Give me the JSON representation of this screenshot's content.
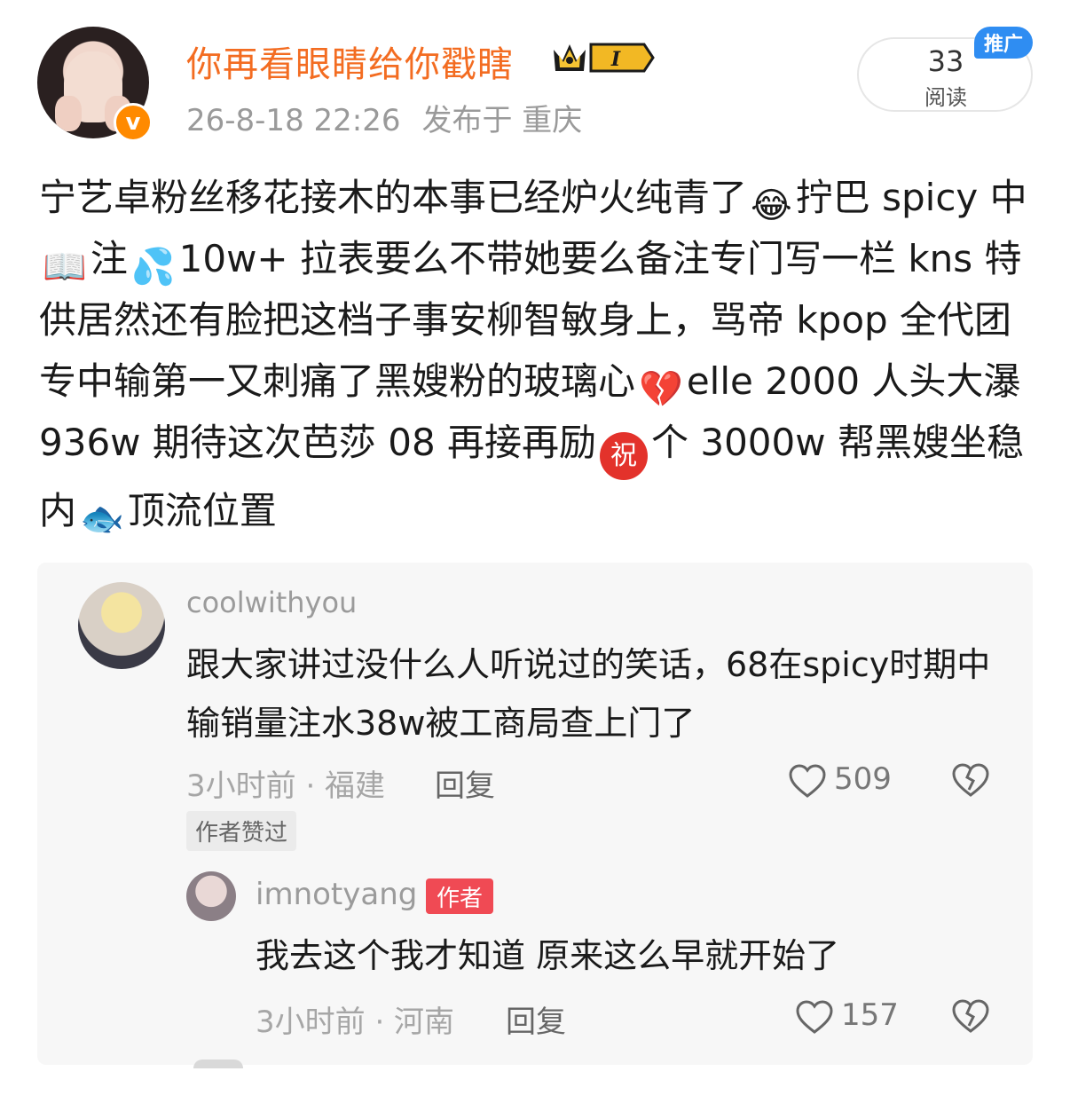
{
  "post": {
    "username": "你再看眼睛给你戳瞎",
    "level_badge": "I",
    "date": "26-8-18 22:26",
    "location": "发布于 重庆",
    "reads_count": "33",
    "reads_label": "阅读",
    "promo_tag": "推广",
    "body": {
      "p1": "宁艺卓粉丝移花接木的本事已经炉火纯青了",
      "p2": "拧巴 spicy 中",
      "p3": "注",
      "p4": "10w+ 拉表要么不带她要么备注专门写一栏 kns 特供居然还有脸把这档子事安柳智敏身上，骂帝 kpop 全代团专中输第一又刺痛了黑嫂粉的玻璃心",
      "p5": "elle 2000 人头大瀑 936w 期待这次芭莎 08 再接再励",
      "p6": "个 3000w 帮黑嫂坐稳内",
      "p7": "顶流位置"
    },
    "emoji": {
      "laugh": "😂",
      "book": "📖",
      "sweat": "💦",
      "broken_heart": "💔",
      "wish": "祝",
      "fish": "🐟"
    },
    "colors": {
      "username": "#f36c21",
      "verified": "#ff8a00",
      "promo": "#2f8df2",
      "author_tag": "#f04a54"
    }
  },
  "comment": {
    "username": "coolwithyou",
    "text": "跟大家讲过没什么人听说过的笑话，68在spicy时期中输销量注水38w被工商局查上门了",
    "meta": "3小时前 · 福建",
    "reply_label": "回复",
    "likes": "509",
    "liked_tag": "作者赞过"
  },
  "reply": {
    "username": "imnotyang",
    "author_tag": "作者",
    "text": "我去这个我才知道 原来这么早就开始了",
    "meta": "3小时前 · 河南",
    "reply_label": "回复",
    "likes": "157"
  }
}
